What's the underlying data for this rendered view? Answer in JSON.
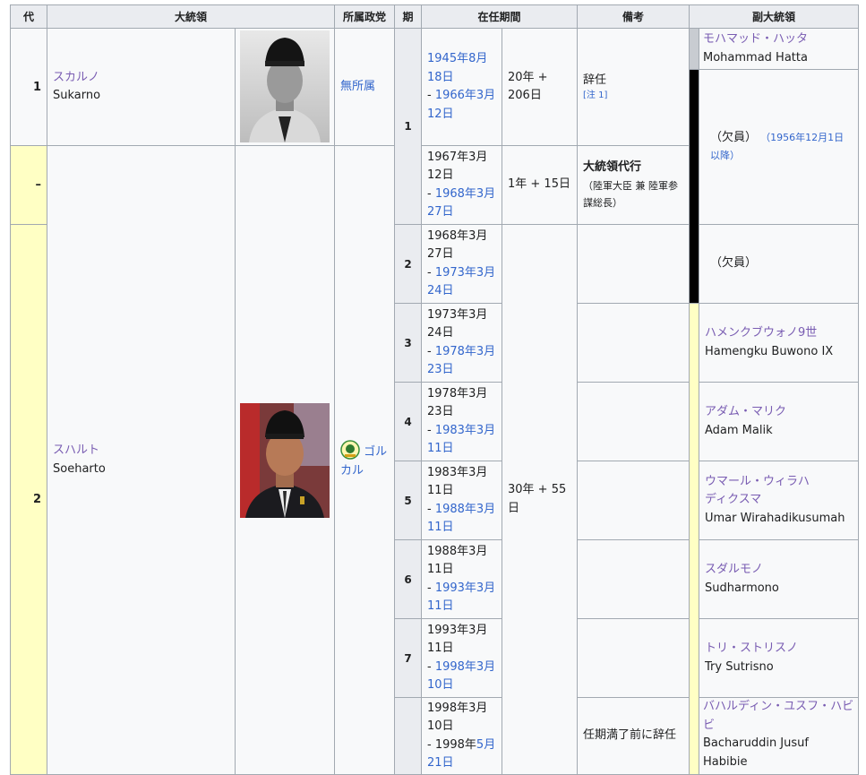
{
  "headers": {
    "dai": "代",
    "president": "大統領",
    "party": "所属政党",
    "ki": "期",
    "term": "在任期間",
    "notes": "備考",
    "vice": "副大統領"
  },
  "presidents": [
    {
      "dai": "1",
      "name_ja": "スカルノ",
      "name_en": "Sukarno",
      "party": "無所属"
    },
    {
      "dai": "–"
    },
    {
      "dai": "2",
      "name_ja": "スハルト",
      "name_en": "Soeharto",
      "party": "ゴルカル"
    }
  ],
  "terms": [
    {
      "ki": "1",
      "start": "1945年8月18日",
      "end_prefix": "- ",
      "end": "1966年3月12日",
      "duration": "20年 + 206日",
      "note": "辞任",
      "note_ref": "[注 1]"
    },
    {
      "start": "1967年3月12日",
      "end_prefix": "- ",
      "end": "1968年3月27日",
      "duration": "1年 + 15日",
      "note_title": "大統領代行",
      "note_detail": "（陸軍大臣 兼 陸軍参謀総長）"
    },
    {
      "ki": "2",
      "start": "1968年3月27日",
      "end_prefix": "- ",
      "end": "1973年3月24日",
      "duration": "30年 + 55日"
    },
    {
      "ki": "3",
      "start": "1973年3月24日",
      "end_prefix": "- ",
      "end": "1978年3月23日"
    },
    {
      "ki": "4",
      "start": "1978年3月23日",
      "end_prefix": "- ",
      "end": "1983年3月11日"
    },
    {
      "ki": "5",
      "start": "1983年3月11日",
      "end_prefix": "- ",
      "end": "1988年3月11日"
    },
    {
      "ki": "6",
      "start": "1988年3月11日",
      "end_prefix": "- ",
      "end": "1993年3月11日"
    },
    {
      "ki": "7",
      "start": "1993年3月11日",
      "end_prefix": "- ",
      "end": "1998年3月10日"
    },
    {
      "start": "1998年3月10日",
      "end_prefix": "- 1998年",
      "end": "5月21日",
      "note": "任期満了前に辞任"
    }
  ],
  "vice_presidents": [
    {
      "name_ja": "モハマッド・ハッタ",
      "name_en": "Mohammad Hatta"
    },
    {
      "vacant": "（欠員）",
      "vacant_note": "（1956年12月1日以降）"
    },
    {
      "vacant": "（欠員）"
    },
    {
      "name_ja": "ハメンクブウォノ9世",
      "name_en": "Hamengku Buwono IX"
    },
    {
      "name_ja": "アダム・マリク",
      "name_en": "Adam Malik"
    },
    {
      "name_ja": "ウマール・ウィラハディクスマ",
      "name_en": "Umar Wirahadikusumah"
    },
    {
      "name_ja": "スダルモノ",
      "name_en": "Sudharmono"
    },
    {
      "name_ja": "トリ・ストリスノ",
      "name_en": "Try Sutrisno"
    },
    {
      "name_ja": "バハルディン・ユスフ・ハビビ",
      "name_en": "Bacharuddin Jusuf Habibie"
    }
  ],
  "colors": {
    "header_bg": "#eaecf0",
    "border": "#a2a9b1",
    "link": "#3366cc",
    "visited_link": "#795cb2",
    "independent_stripe": "#c8ccd1",
    "acting_stripe": "#000000",
    "golkar_stripe": "#ffffc4"
  }
}
